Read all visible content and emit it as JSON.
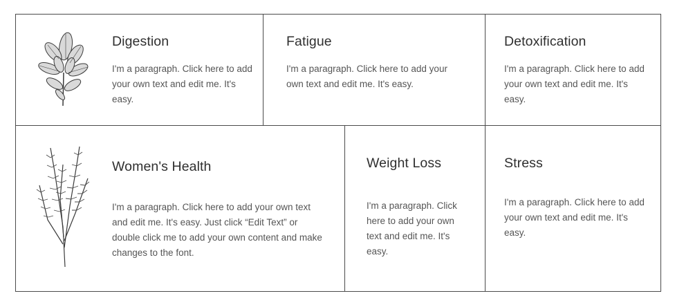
{
  "cards": {
    "digestion": {
      "title": "Digestion",
      "text": "I'm a paragraph. Click here to add your own text and edit me. It's easy.",
      "icon": "sage-leaves-illustration"
    },
    "fatigue": {
      "title": "Fatigue",
      "text": "I'm a paragraph. Click here to add your own text and edit me. It's easy."
    },
    "detoxification": {
      "title": "Detoxification",
      "text": "I'm a paragraph. Click here to add your own text and edit me. It's easy."
    },
    "womens_health": {
      "title": "Women's Health",
      "text": "I'm a paragraph. Click here to add your own text and edit me. It's easy. Just click “Edit Text” or double click me to add your own content and make changes to the font.",
      "icon": "rosemary-sprig-illustration"
    },
    "weight_loss": {
      "title": "Weight Loss",
      "text": "I'm a paragraph. Click here to add your own text and edit me. It's easy."
    },
    "stress": {
      "title": "Stress",
      "text": "I'm a paragraph. Click here to add your own text and edit me. It's easy."
    }
  },
  "colors": {
    "border": "#4a4a4a",
    "title": "#2f2f2f",
    "text": "#555555",
    "background": "#ffffff"
  }
}
